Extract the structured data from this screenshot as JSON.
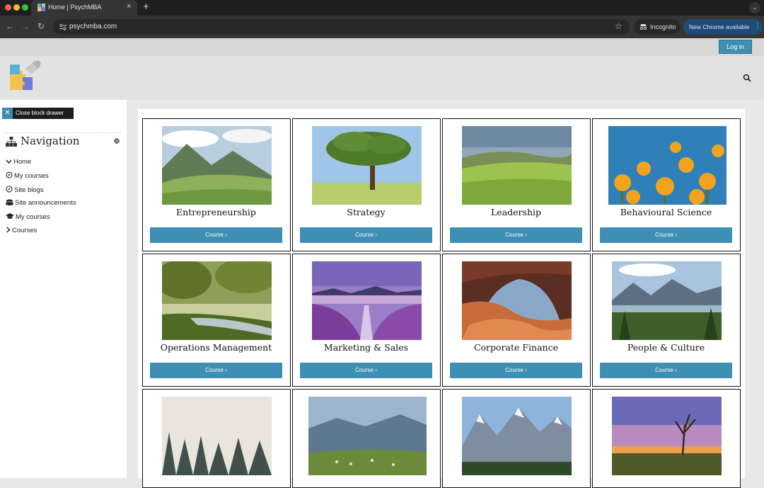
{
  "browser": {
    "tab_title": "Home | PsychMBA",
    "url": "psychmba.com",
    "incognito_label": "Incognito",
    "update_label": "New Chrome available"
  },
  "site": {
    "login_label": "Log in",
    "close_drawer_label": "Close block drawer",
    "navigation": {
      "title": "Navigation",
      "items": [
        {
          "label": "Home",
          "icon": "chevron-down-icon"
        },
        {
          "label": "My courses",
          "icon": "compass-icon"
        },
        {
          "label": "Site blogs",
          "icon": "compass-icon"
        },
        {
          "label": "Site announcements",
          "icon": "users-icon"
        },
        {
          "label": "My courses",
          "icon": "graduation-cap-icon"
        },
        {
          "label": "Courses",
          "icon": "chevron-right-icon"
        }
      ]
    },
    "courses": [
      {
        "title": "Entrepreneurship",
        "button": "Course ›",
        "image": "mountain-valley"
      },
      {
        "title": "Strategy",
        "button": "Course ›",
        "image": "tree"
      },
      {
        "title": "Leadership",
        "button": "Course ›",
        "image": "green-hills"
      },
      {
        "title": "Behavioural Science",
        "button": "Course ›",
        "image": "orange-flowers"
      },
      {
        "title": "Operations Management",
        "button": "Course ›",
        "image": "forest-stream"
      },
      {
        "title": "Marketing & Sales",
        "button": "Course ›",
        "image": "lavender-lake"
      },
      {
        "title": "Corporate Finance",
        "button": "Course ›",
        "image": "canyon-arch"
      },
      {
        "title": "People & Culture",
        "button": "Course ›",
        "image": "mountain-lake"
      },
      {
        "title": "",
        "button": "",
        "image": "misty-forest"
      },
      {
        "title": "",
        "button": "",
        "image": "sheep-hills"
      },
      {
        "title": "",
        "button": "",
        "image": "snow-mountains"
      },
      {
        "title": "",
        "button": "",
        "image": "sunset-tree"
      }
    ]
  },
  "colors": {
    "accent": "#3f8fb4",
    "chrome_dark": "#1f1f1f",
    "header_bg": "#e2e2e2"
  }
}
